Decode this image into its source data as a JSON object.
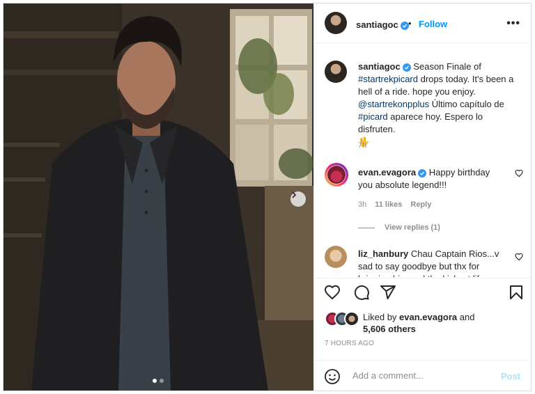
{
  "post": {
    "username": "santiagoc",
    "bullet": "•",
    "follow_label": "Follow",
    "more_label": "•••"
  },
  "caption": {
    "username": "santiagoc",
    "text_1": "Season Finale of",
    "hashtag_1": "#startrekpicard",
    "text_2": "drops today. It's been a hell of a ride. hope you enjoy.",
    "mention": "@startrekonpplus",
    "text_3": "Último capítulo de",
    "hashtag_2": "#picard",
    "text_4": "aparece hoy. Espero lo disfruten.",
    "emoji": "🖖",
    "time": "7h"
  },
  "comments": [
    {
      "username": "evan.evagora",
      "text": "Happy birthday you absolute legend!!!",
      "time": "3h",
      "likes": "11 likes",
      "reply_label": "Reply",
      "view_replies": "View replies (1)"
    },
    {
      "username": "liz_hanbury",
      "text": "Chau Captain Rios...v sad to say goodbye but thx for bringing him and the kickest life"
    }
  ],
  "likes": {
    "prefix": "Liked by",
    "user": "evan.evagora",
    "conj": "and",
    "others": "5,606 others"
  },
  "timestamp": "7 HOURS AGO",
  "add_comment": {
    "placeholder": "Add a comment...",
    "post_label": "Post"
  },
  "icons": {
    "verified": "verified-badge-icon",
    "heart": "heart-icon",
    "comment": "comment-icon",
    "share": "share-icon",
    "save": "bookmark-icon",
    "emoji": "emoji-icon",
    "next": "chevron-right-icon",
    "more": "more-options-icon"
  },
  "colors": {
    "accent": "#0095f6",
    "verified": "#3897f0",
    "link": "#00376b",
    "muted": "#8e8e8e",
    "border": "#dbdbdb"
  },
  "carousel": {
    "current_slide": 1,
    "total_slides": 2
  }
}
